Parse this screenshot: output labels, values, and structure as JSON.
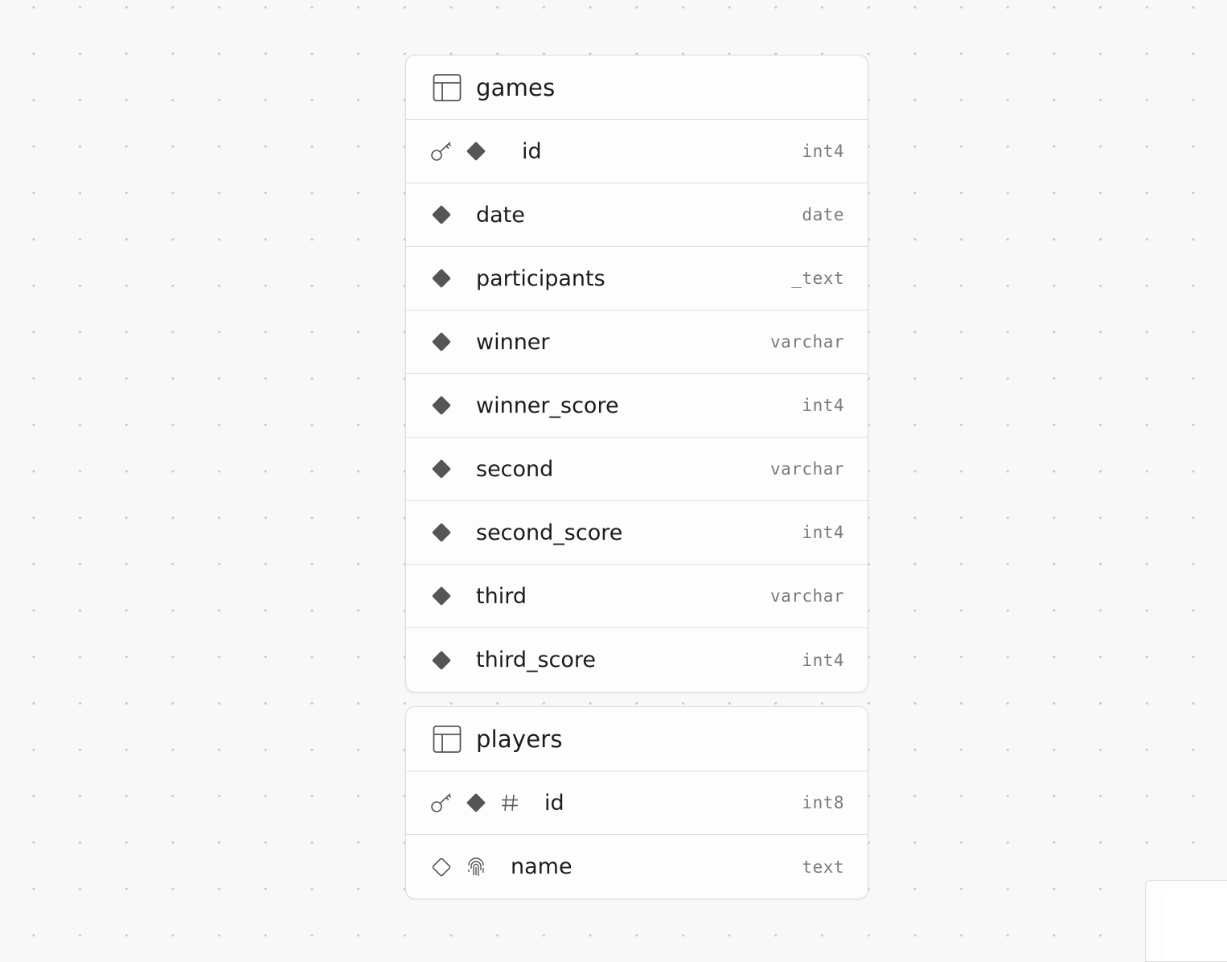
{
  "tables": [
    {
      "name": "games",
      "columns": [
        {
          "name": "id",
          "type": "int4"
        },
        {
          "name": "date",
          "type": "date"
        },
        {
          "name": "participants",
          "type": "_text"
        },
        {
          "name": "winner",
          "type": "varchar"
        },
        {
          "name": "winner_score",
          "type": "int4"
        },
        {
          "name": "second",
          "type": "varchar"
        },
        {
          "name": "second_score",
          "type": "int4"
        },
        {
          "name": "third",
          "type": "varchar"
        },
        {
          "name": "third_score",
          "type": "int4"
        }
      ]
    },
    {
      "name": "players",
      "columns": [
        {
          "name": "id",
          "type": "int8"
        },
        {
          "name": "name",
          "type": "text"
        }
      ]
    }
  ],
  "icons": {
    "table": "table-icon",
    "primary_key": "key-icon",
    "not_null": "filled-diamond-icon",
    "nullable": "outline-diamond-icon",
    "identity": "hash-icon",
    "unique": "fingerprint-icon"
  },
  "colors": {
    "canvas": "#f8f8f8",
    "grid_dot": "#c9c9c9",
    "card": "#fdfdfd",
    "border": "#dcdcdc",
    "text": "#1c1c1c",
    "type_text": "#7a7a7a",
    "icon": "#555555"
  }
}
